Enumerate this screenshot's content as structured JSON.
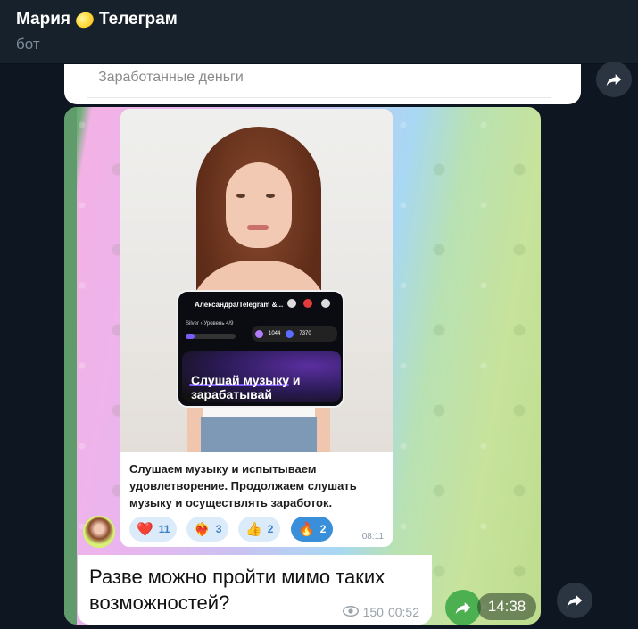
{
  "header": {
    "title": "Мария",
    "title_suffix": "Телеграм",
    "title_emoji": "lemon",
    "subtitle": "бот"
  },
  "top_message": {
    "text": "Заработанные деньги"
  },
  "post": {
    "mock_title": "Александра/Telegram &...",
    "mock_badge": "2",
    "mock_level_label": "Silver ›",
    "mock_level": "Уровень 4/9",
    "mock_stat_1": "1044",
    "mock_stat_2": "7370",
    "mock_balance_label": "Баланс",
    "banner_line": "Слушай музыку и зарабатывай",
    "text": "Слушаем музыку и испытываем удовлетворение. Продолжаем слушать музыку и осуществлять заработок.",
    "reactions": [
      {
        "emoji": "❤️",
        "count": "11",
        "selected": false
      },
      {
        "emoji": "❤️‍🔥",
        "count": "3",
        "selected": false
      },
      {
        "emoji": "👍",
        "count": "2",
        "selected": false
      },
      {
        "emoji": "🔥",
        "count": "2",
        "selected": true
      }
    ],
    "time": "08:11"
  },
  "caption": {
    "text": "Разве можно пройти мимо таких возможностей?",
    "views": "150",
    "time": "00:52"
  },
  "outer_time": "14:38",
  "colors": {
    "header_bg": "#17212b",
    "reaction_bg": "#dcebf9",
    "reaction_selected": "#3a8fdb",
    "share_green": "#4caf50"
  }
}
